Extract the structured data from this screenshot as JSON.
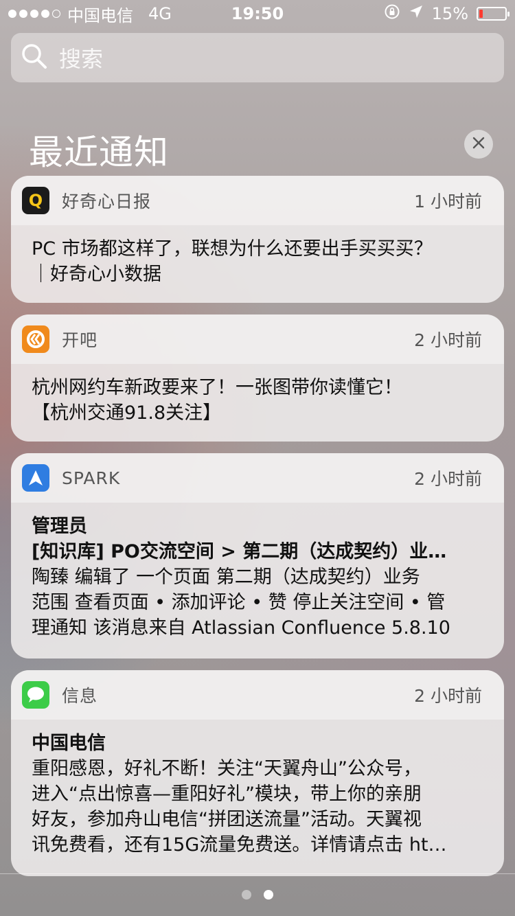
{
  "status_bar": {
    "carrier": "中国电信",
    "network": "4G",
    "time": "19:50",
    "battery_pct": "15%",
    "battery_level": 0.15,
    "signal_icon": "signal-dots-icon",
    "lock_rotation_icon": "orientation-lock-icon",
    "location_icon": "location-arrow-icon",
    "battery_icon": "battery-icon",
    "battery_color": "#ff3b30"
  },
  "search": {
    "placeholder": "搜索",
    "icon": "search-icon"
  },
  "section": {
    "title": "最近通知",
    "clear_icon": "close-icon"
  },
  "notifications": [
    {
      "app": "好奇心日报",
      "time": "1 小时前",
      "icon": "qdaily-app-icon",
      "icon_color": "#1b1b1b",
      "icon_text": "Q",
      "body": [
        "PC 市场都这样了，联想为什么还要出手买买买？",
        "｜好奇心小数据"
      ]
    },
    {
      "app": "开吧",
      "time": "2 小时前",
      "icon": "kaiba-app-icon",
      "icon_color": "#f08a1c",
      "body": [
        "杭州网约车新政要来了！一张图带你读懂它！",
        "【杭州交通91.8关注】"
      ]
    },
    {
      "app": "SPARK",
      "time": "2 小时前",
      "icon": "spark-app-icon",
      "icon_color": "#2f7de1",
      "title": "管理员",
      "subtitle": "[知识库] PO交流空间 > 第二期（达成契约）业…",
      "body": [
        "陶臻 编辑了 一个页面 第二期（达成契约）业务",
        "范围 查看页面 • 添加评论 • 赞 停止关注空间 • 管",
        "理通知 该消息来自 Atlassian Confluence 5.8.10"
      ]
    },
    {
      "app": "信息",
      "time": "2 小时前",
      "icon": "messages-app-icon",
      "icon_color": "#3ccc48",
      "title": "中国电信",
      "body": [
        "重阳感恩，好礼不断！关注“天翼舟山”公众号，",
        "进入“点出惊喜—重阳好礼”模块，带上你的亲朋",
        "好友，参加舟山电信“拼团送流量”活动。天翼视",
        "讯免费看，还有15G流量免费送。详情请点击 ht…"
      ]
    }
  ],
  "page_indicator": {
    "pages": 2,
    "current": 2
  }
}
